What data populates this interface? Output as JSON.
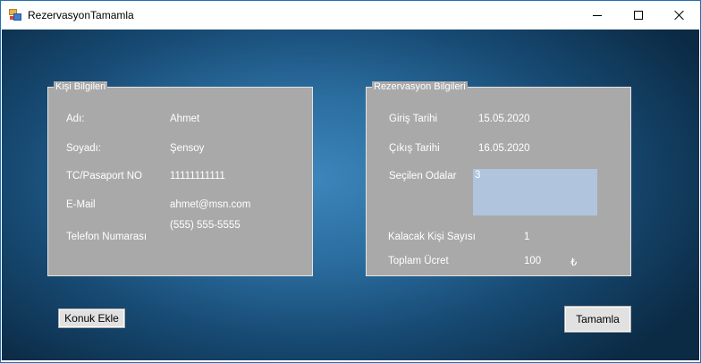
{
  "window": {
    "title": "RezervasyonTamamla"
  },
  "person": {
    "legend": "Kişi Bilgileri",
    "first_name_label": "Adı:",
    "first_name": "Ahmet",
    "last_name_label": "Soyadı:",
    "last_name": "Şensoy",
    "id_label": "TC/Pasaport NO",
    "id_number": "11111111111",
    "email_label": "E-Mail",
    "email": "ahmet@msn.com",
    "phone_label": "Telefon Numarası",
    "phone": "(555) 555-5555"
  },
  "reservation": {
    "legend": "Rezervasyon Bilgileri",
    "checkin_label": "Giriş Tarihi",
    "checkin": "15.05.2020",
    "checkout_label": "Çıkış Tarihi",
    "checkout": "16.05.2020",
    "rooms_label": "Seçilen Odalar",
    "rooms": [
      "3"
    ],
    "guests_label": "Kalacak Kişi Sayısı",
    "guests": "1",
    "total_label": "Toplam Ücret",
    "total": "100",
    "currency": "₺"
  },
  "buttons": {
    "add_guest": "Konuk Ekle",
    "complete": "Tamamla"
  },
  "icons": {
    "app": "windows-form-icon",
    "minimize": "minimize-icon",
    "maximize": "maximize-icon",
    "close": "close-icon"
  }
}
